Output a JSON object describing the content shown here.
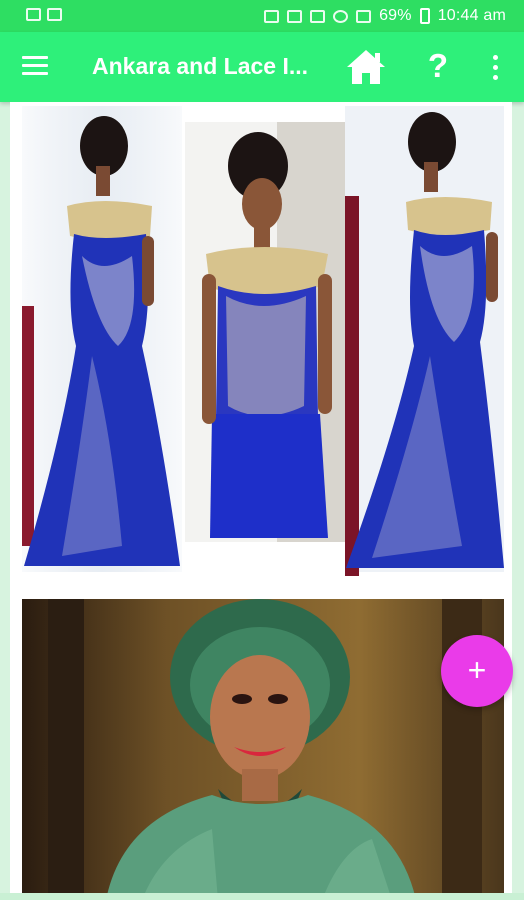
{
  "status_bar": {
    "battery_percent": "69%",
    "time": "10:44 am"
  },
  "app_bar": {
    "title": "Ankara and Lace I...",
    "menu_icon": "hamburger-menu-icon",
    "home_icon": "home-icon",
    "help_label": "?",
    "more_icon": "more-vert-icon"
  },
  "images": [
    {
      "alt": "three views of royal blue mermaid gown with gold lace off-shoulder top"
    },
    {
      "alt": "woman in green lace dress with matching green gele headwrap"
    }
  ],
  "fab": {
    "label": "+"
  },
  "colors": {
    "status_bar": "#2ede62",
    "app_bar": "#2ef07a",
    "fab": "#ea3be9",
    "page_background": "#d7f3df"
  }
}
